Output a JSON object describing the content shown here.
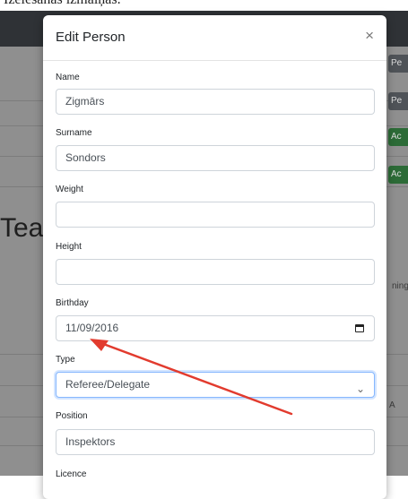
{
  "caption": {
    "text": "Izelesanas izmaiņas."
  },
  "background": {
    "buttons": [
      "Pe",
      "Pe",
      "Ac",
      "Ac"
    ],
    "heading": "Tea",
    "side_text_1": "ning",
    "side_text_2": "A"
  },
  "modal": {
    "title": "Edit Person",
    "close_label": "×",
    "fields": {
      "name": {
        "label": "Name",
        "value": "Zigmārs"
      },
      "surname": {
        "label": "Surname",
        "value": "Sondors"
      },
      "weight": {
        "label": "Weight",
        "value": ""
      },
      "height": {
        "label": "Height",
        "value": ""
      },
      "birthday": {
        "label": "Birthday",
        "value": "11/09/2016"
      },
      "type": {
        "label": "Type",
        "value": "Referee/Delegate"
      },
      "position": {
        "label": "Position",
        "value": "Inspektors"
      },
      "licence": {
        "label": "Licence"
      }
    }
  },
  "annotation": {
    "arrow_color": "#e23b2e"
  }
}
